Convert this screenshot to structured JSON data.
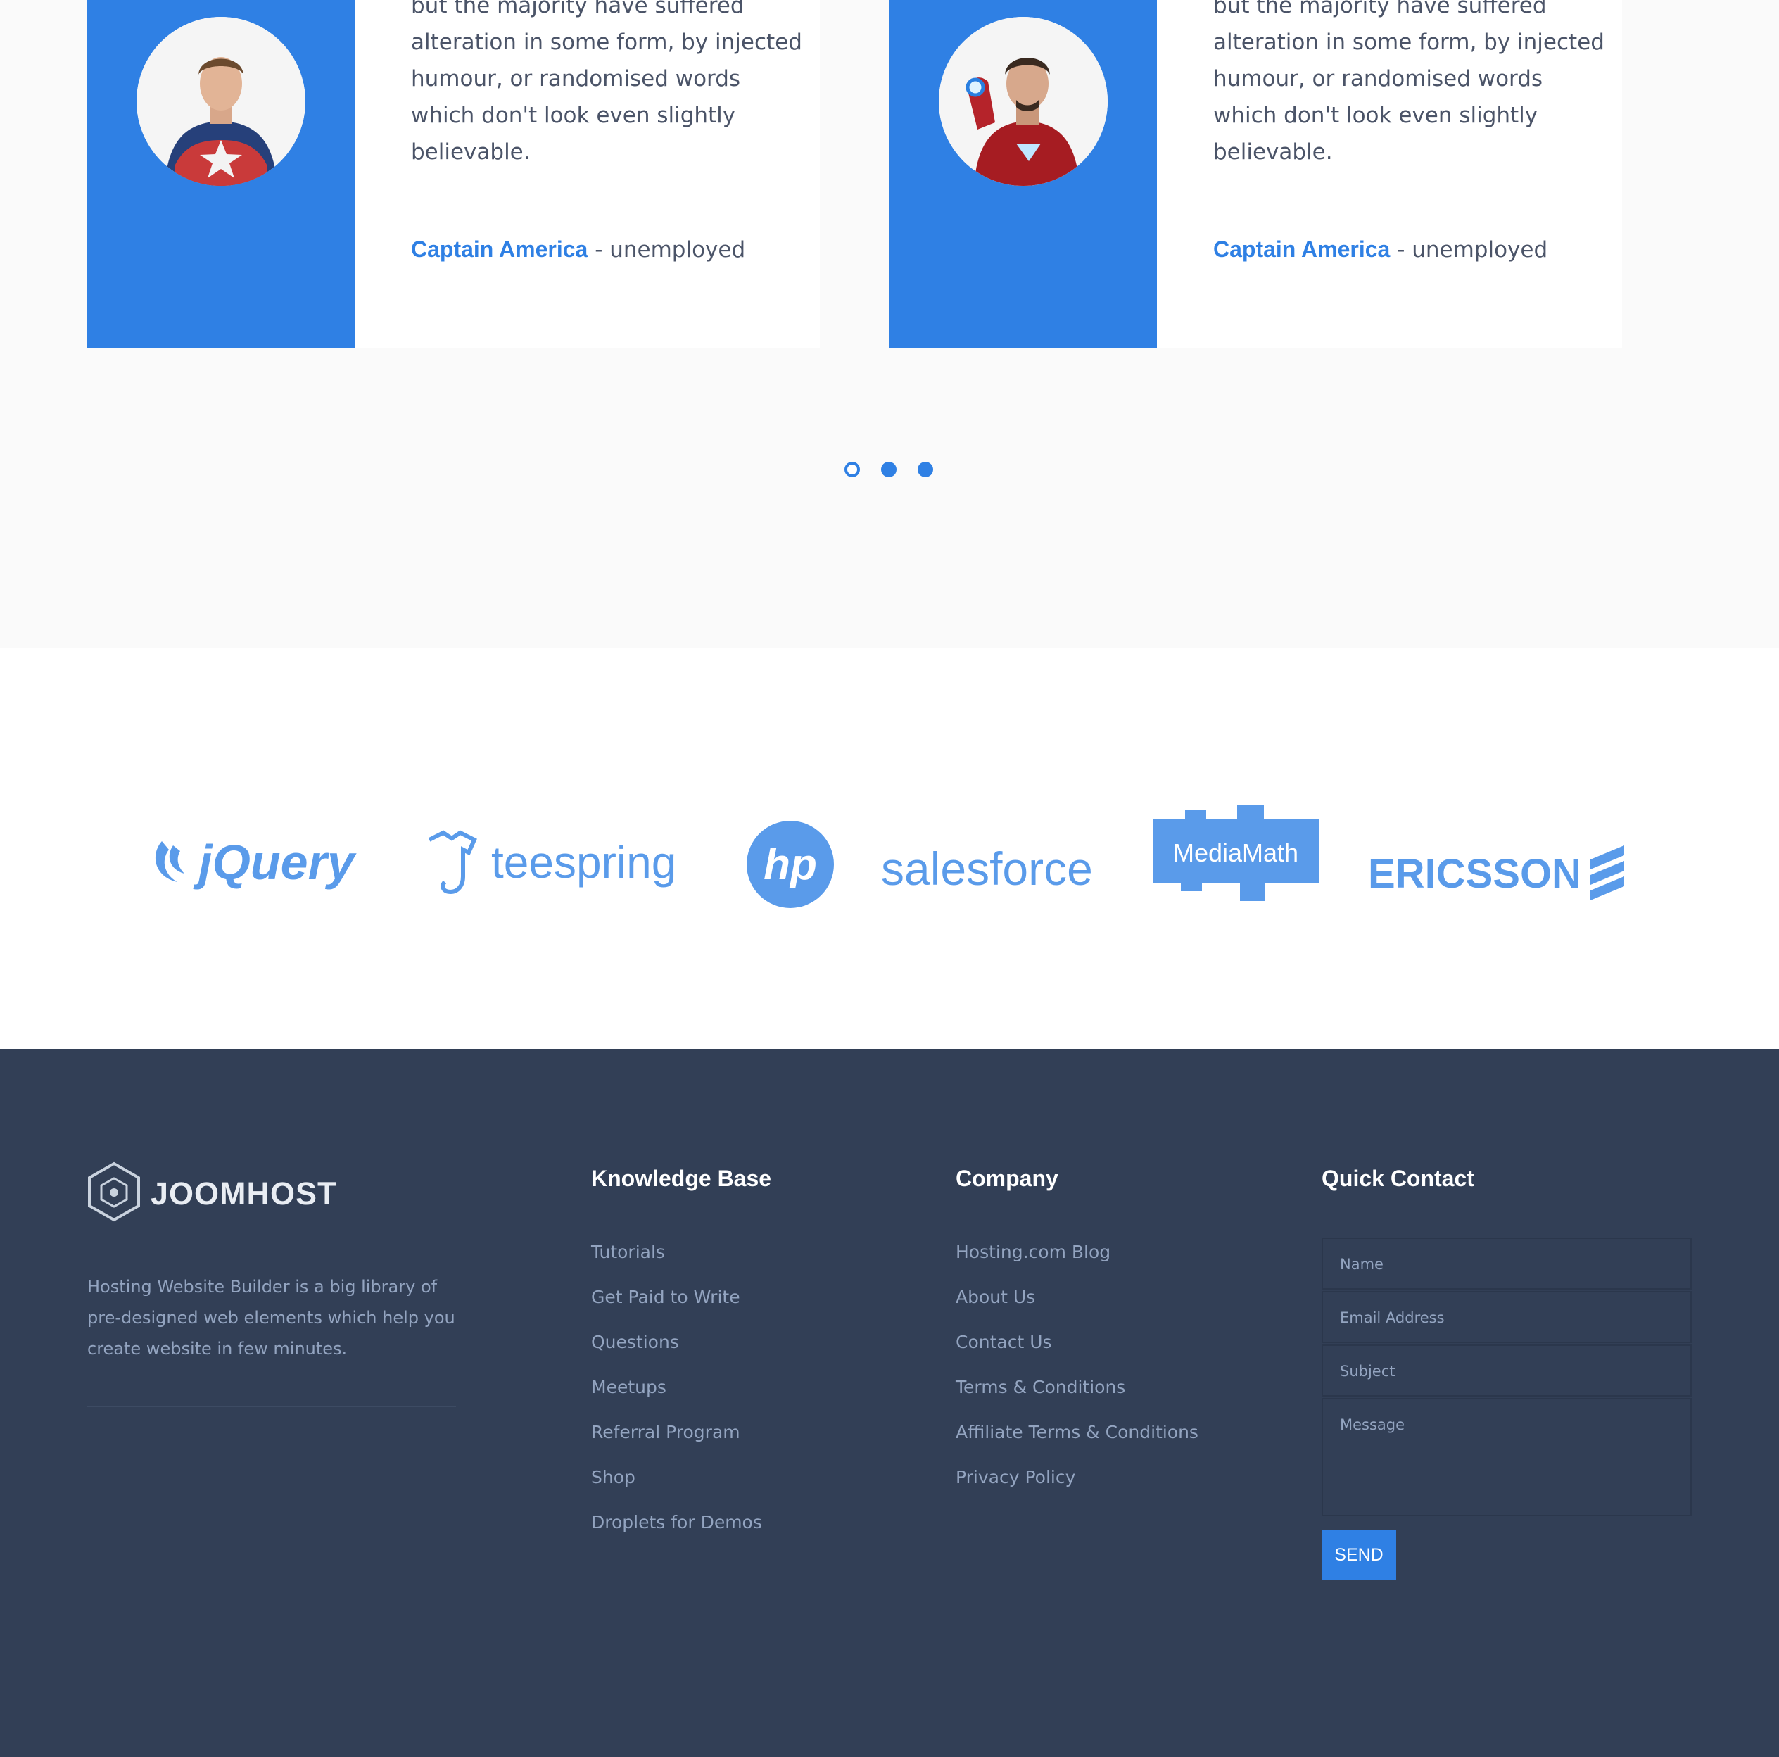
{
  "testimonials": [
    {
      "quote": "but the majority have suffered alteration in some form, by injected humour, or randomised words which don't look even slightly believable.",
      "author_name": "Captain America",
      "author_role": " - unemployed",
      "avatar_icon": "captain-america-portrait"
    },
    {
      "quote": "but the majority have suffered alteration in some form, by injected humour, or randomised words which don't look even slightly believable.",
      "author_name": "Captain America",
      "author_role": " - unemployed",
      "avatar_icon": "iron-man-portrait"
    }
  ],
  "carousel": {
    "active_index": 0,
    "count": 3
  },
  "clients": {
    "logos": [
      "jQuery",
      "teespring",
      "hp",
      "salesforce",
      "MediaMath",
      "ERICSSON"
    ],
    "color": "#5a9bea"
  },
  "footer": {
    "brand": "JOOMHOST",
    "about": "Hosting Website Builder is a big library of pre-designed web elements which help you create website in few minutes.",
    "knowledge_base": {
      "title": "Knowledge Base",
      "links": [
        "Tutorials",
        "Get Paid to Write",
        "Questions",
        "Meetups",
        "Referral Program",
        "Shop",
        "Droplets for Demos"
      ]
    },
    "company": {
      "title": "Company",
      "links": [
        "Hosting.com Blog",
        "About Us",
        "Contact Us",
        "Terms & Conditions",
        "Affiliate Terms & Conditions",
        "Privacy Policy"
      ]
    },
    "quick_contact": {
      "title": "Quick Contact",
      "name_placeholder": "Name",
      "email_placeholder": "Email Address",
      "subject_placeholder": "Subject",
      "message_placeholder": "Message",
      "send_label": "SEND"
    }
  },
  "colors": {
    "accent": "#2f80e4",
    "footer_bg": "#323f56",
    "muted_text": "#93a4c0"
  }
}
